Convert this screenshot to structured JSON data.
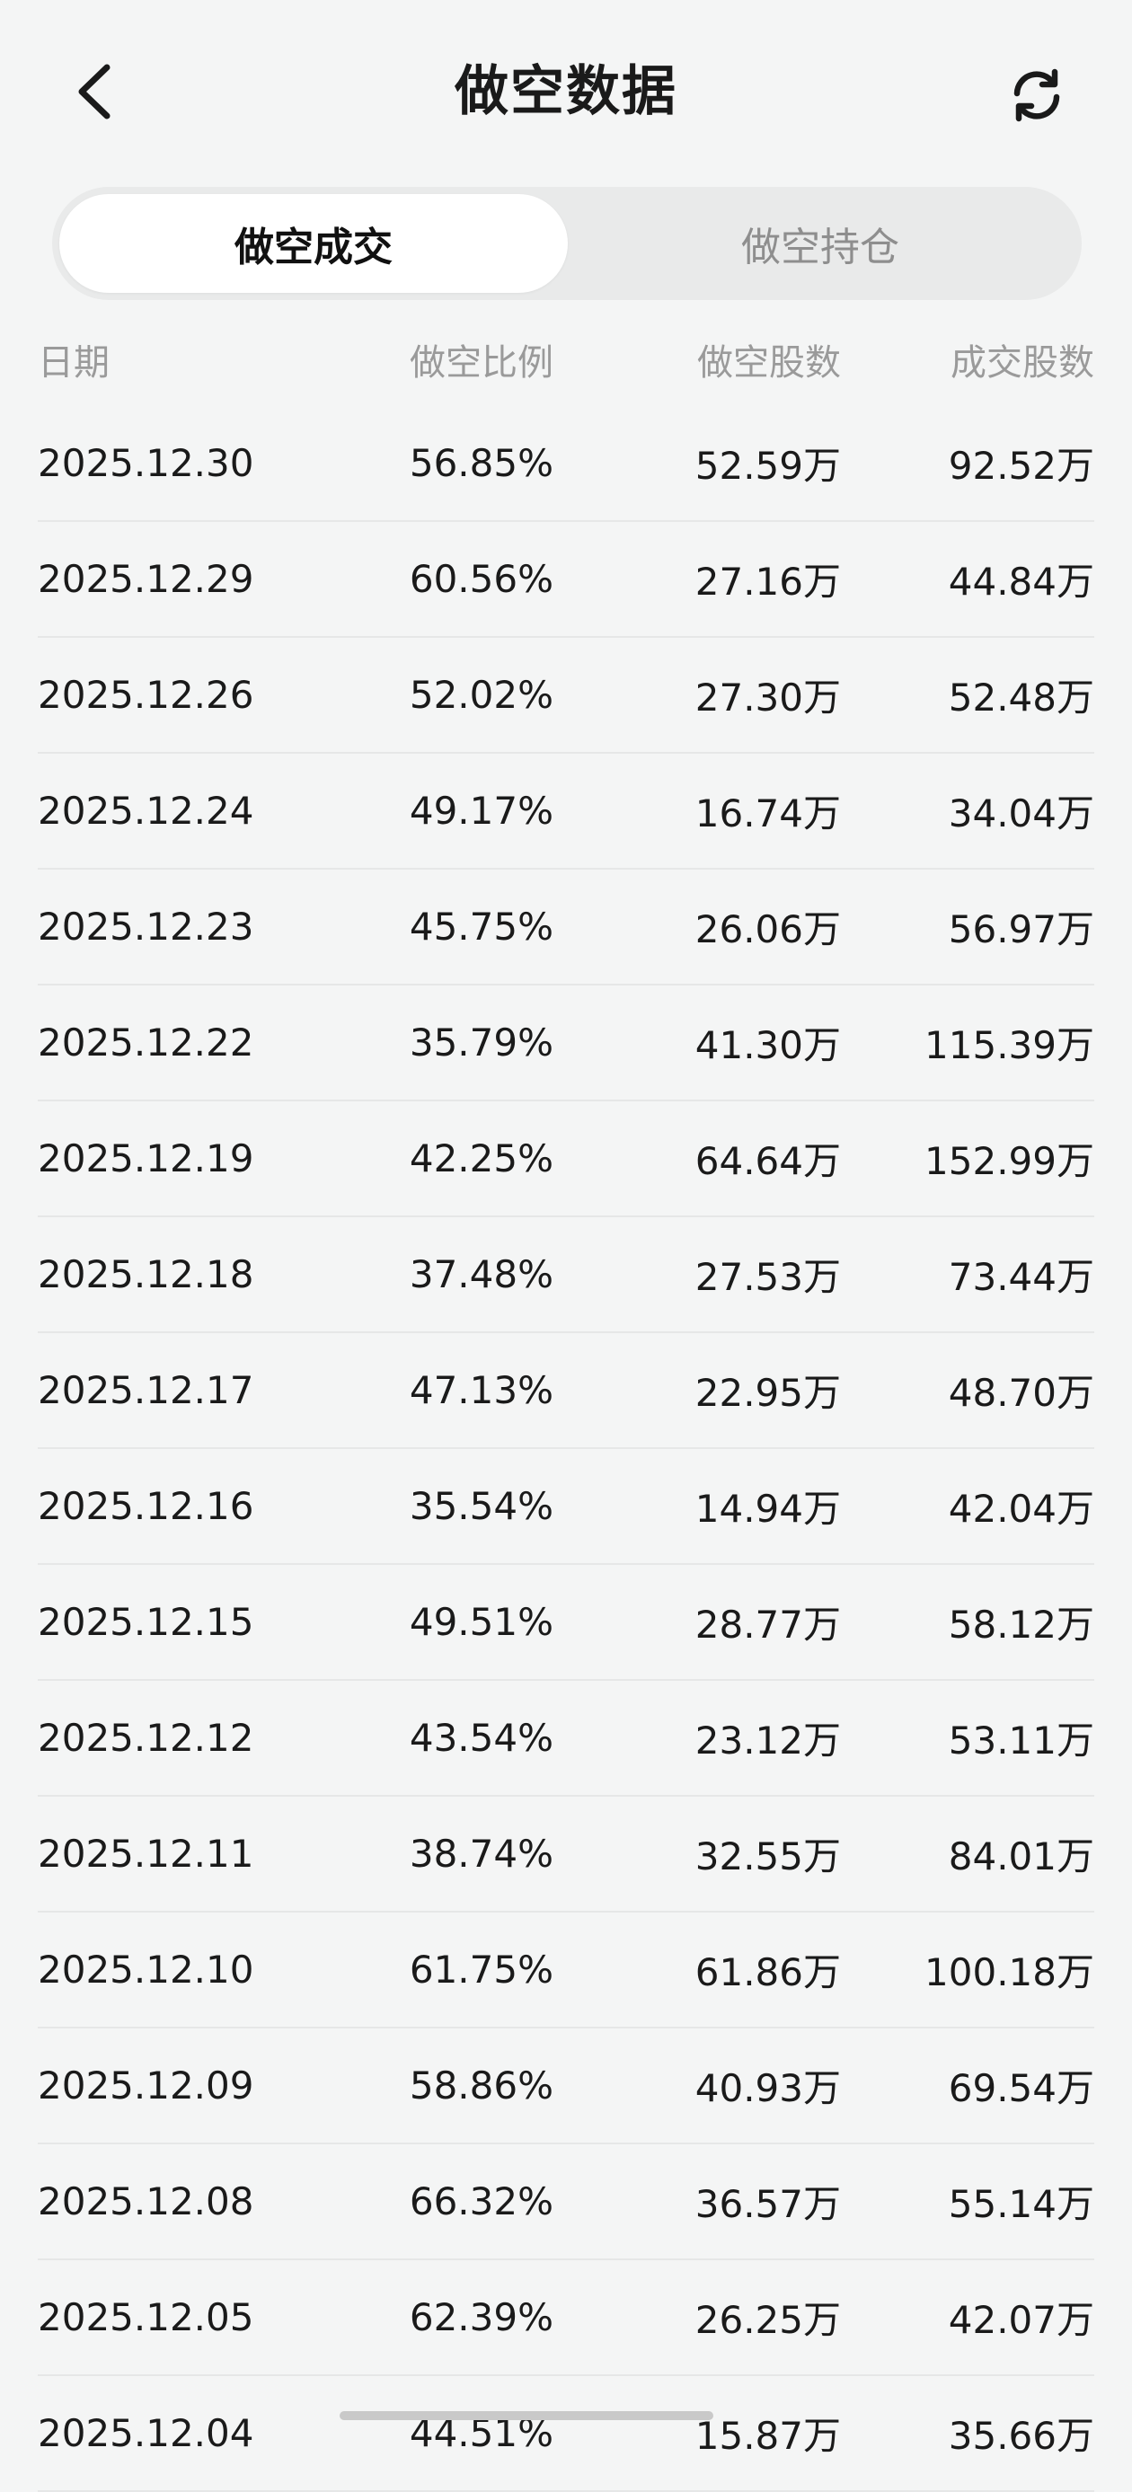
{
  "header": {
    "title": "做空数据",
    "back_icon": "chevron-left-icon",
    "refresh_icon": "refresh-icon"
  },
  "tabs": [
    {
      "label": "做空成交",
      "active": true
    },
    {
      "label": "做空持仓",
      "active": false
    }
  ],
  "table": {
    "columns": [
      "日期",
      "做空比例",
      "做空股数",
      "成交股数"
    ],
    "rows": [
      {
        "date": "2025.12.30",
        "ratio": "56.85%",
        "short": "52.59万",
        "volume": "92.52万"
      },
      {
        "date": "2025.12.29",
        "ratio": "60.56%",
        "short": "27.16万",
        "volume": "44.84万"
      },
      {
        "date": "2025.12.26",
        "ratio": "52.02%",
        "short": "27.30万",
        "volume": "52.48万"
      },
      {
        "date": "2025.12.24",
        "ratio": "49.17%",
        "short": "16.74万",
        "volume": "34.04万"
      },
      {
        "date": "2025.12.23",
        "ratio": "45.75%",
        "short": "26.06万",
        "volume": "56.97万"
      },
      {
        "date": "2025.12.22",
        "ratio": "35.79%",
        "short": "41.30万",
        "volume": "115.39万"
      },
      {
        "date": "2025.12.19",
        "ratio": "42.25%",
        "short": "64.64万",
        "volume": "152.99万"
      },
      {
        "date": "2025.12.18",
        "ratio": "37.48%",
        "short": "27.53万",
        "volume": "73.44万"
      },
      {
        "date": "2025.12.17",
        "ratio": "47.13%",
        "short": "22.95万",
        "volume": "48.70万"
      },
      {
        "date": "2025.12.16",
        "ratio": "35.54%",
        "short": "14.94万",
        "volume": "42.04万"
      },
      {
        "date": "2025.12.15",
        "ratio": "49.51%",
        "short": "28.77万",
        "volume": "58.12万"
      },
      {
        "date": "2025.12.12",
        "ratio": "43.54%",
        "short": "23.12万",
        "volume": "53.11万"
      },
      {
        "date": "2025.12.11",
        "ratio": "38.74%",
        "short": "32.55万",
        "volume": "84.01万"
      },
      {
        "date": "2025.12.10",
        "ratio": "61.75%",
        "short": "61.86万",
        "volume": "100.18万"
      },
      {
        "date": "2025.12.09",
        "ratio": "58.86%",
        "short": "40.93万",
        "volume": "69.54万"
      },
      {
        "date": "2025.12.08",
        "ratio": "66.32%",
        "short": "36.57万",
        "volume": "55.14万"
      },
      {
        "date": "2025.12.05",
        "ratio": "62.39%",
        "short": "26.25万",
        "volume": "42.07万"
      },
      {
        "date": "2025.12.04",
        "ratio": "44.51%",
        "short": "15.87万",
        "volume": "35.66万"
      }
    ]
  }
}
